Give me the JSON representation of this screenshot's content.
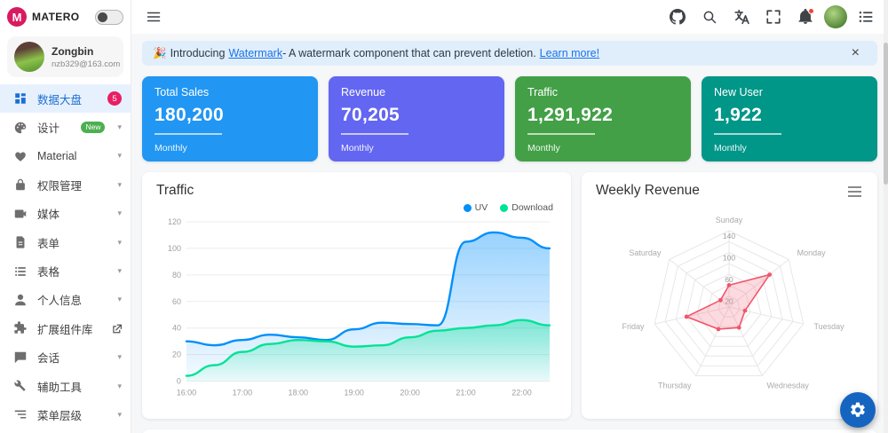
{
  "brand": {
    "logo_letter": "M",
    "name": "MATERO"
  },
  "sidebar": {
    "user": {
      "name": "Zongbin",
      "email": "nzb329@163.com"
    },
    "items": [
      {
        "label": "数据大盘",
        "icon": "dashboard-icon",
        "badge": "5",
        "active": true
      },
      {
        "label": "设计",
        "icon": "palette-icon",
        "badge": "New",
        "expandable": true
      },
      {
        "label": "Material",
        "icon": "heart-icon",
        "expandable": true
      },
      {
        "label": "权限管理",
        "icon": "lock-icon",
        "expandable": true
      },
      {
        "label": "媒体",
        "icon": "media-icon",
        "expandable": true
      },
      {
        "label": "表单",
        "icon": "form-icon",
        "expandable": true
      },
      {
        "label": "表格",
        "icon": "table-icon",
        "expandable": true
      },
      {
        "label": "个人信息",
        "icon": "person-icon",
        "expandable": true
      },
      {
        "label": "扩展组件库",
        "icon": "extension-icon",
        "external": true
      },
      {
        "label": "会话",
        "icon": "chat-icon",
        "expandable": true
      },
      {
        "label": "辅助工具",
        "icon": "tools-icon",
        "expandable": true
      },
      {
        "label": "菜单层级",
        "icon": "menu-level-icon",
        "expandable": true
      }
    ],
    "chevron": "▾"
  },
  "header": {
    "icons": [
      "menu",
      "github",
      "search",
      "translate",
      "fullscreen",
      "notifications",
      "avatar",
      "list"
    ]
  },
  "banner": {
    "emoji": "🎉",
    "intro": "Introducing",
    "watermark_link": "Watermark",
    "description": "- A watermark component that can prevent deletion.",
    "learn_more_link": "Learn more!",
    "close_icon": "×"
  },
  "stats": [
    {
      "title": "Total Sales",
      "value": "180,200",
      "period": "Monthly",
      "color": "#2196f3"
    },
    {
      "title": "Revenue",
      "value": "70,205",
      "period": "Monthly",
      "color": "#6366f1"
    },
    {
      "title": "Traffic",
      "value": "1,291,922",
      "period": "Monthly",
      "color": "#43a047"
    },
    {
      "title": "New User",
      "value": "1,922",
      "period": "Monthly",
      "color": "#009688"
    }
  ],
  "traffic_card": {
    "title": "Traffic"
  },
  "weekly_card": {
    "title": "Weekly Revenue"
  },
  "chart_data": [
    {
      "type": "area",
      "title": "Traffic",
      "x": [
        "16:00",
        "16:30",
        "17:00",
        "17:30",
        "18:00",
        "18:30",
        "19:00",
        "19:30",
        "20:00",
        "20:30",
        "21:00",
        "21:30",
        "22:00",
        "22:30"
      ],
      "x_tick_labels": [
        "16:00",
        "17:00",
        "18:00",
        "19:00",
        "20:00",
        "21:00",
        "22:00"
      ],
      "series": [
        {
          "name": "UV",
          "color": "#008FFB",
          "values": [
            30,
            27,
            31,
            35,
            33,
            31,
            39,
            44,
            43,
            42,
            105,
            112,
            108,
            100
          ]
        },
        {
          "name": "Download",
          "color": "#00E396",
          "values": [
            4,
            12,
            22,
            28,
            31,
            30,
            26,
            27,
            33,
            38,
            40,
            42,
            46,
            42
          ]
        }
      ],
      "ylim": [
        0,
        120
      ],
      "yticks": [
        0,
        20,
        40,
        60,
        80,
        100,
        120
      ],
      "grid": true,
      "legend_position": "top-right"
    },
    {
      "type": "radar",
      "title": "Weekly Revenue",
      "categories": [
        "Sunday",
        "Monday",
        "Tuesday",
        "Wednesday",
        "Thursday",
        "Friday",
        "Saturday"
      ],
      "values": [
        40,
        95,
        30,
        42,
        45,
        80,
        20
      ],
      "max": 140,
      "ring_interval": 20,
      "ticks": [
        20,
        60,
        100,
        140
      ],
      "color": "#f1556c"
    }
  ]
}
